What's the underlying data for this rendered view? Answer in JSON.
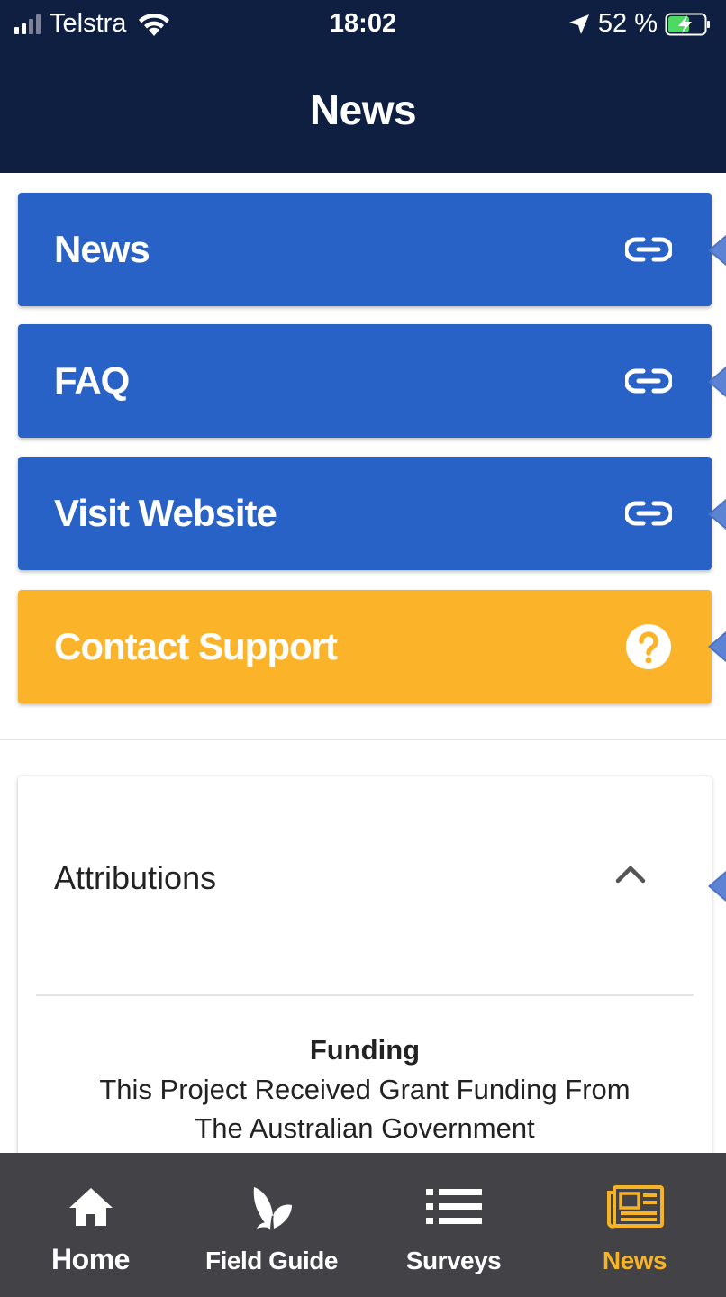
{
  "status_bar": {
    "carrier": "Telstra",
    "time": "18:02",
    "battery_percent": "52 %"
  },
  "header": {
    "title": "News"
  },
  "links": [
    {
      "label": "News",
      "icon": "link-icon"
    },
    {
      "label": "FAQ",
      "icon": "link-icon"
    },
    {
      "label": "Visit Website",
      "icon": "link-icon"
    },
    {
      "label": "Contact Support",
      "icon": "question-circle-icon"
    }
  ],
  "colors": {
    "header_bg": "#0e1f42",
    "link_button": "#2862c6",
    "support_button": "#fbb42a",
    "tabbar_bg": "#434246",
    "tab_active": "#f5b325"
  },
  "attributions": {
    "title": "Attributions",
    "expanded": true,
    "heading": "Funding",
    "body_line1": "This Project Received Grant Funding From",
    "body_line2": "The Australian Government"
  },
  "tabs": [
    {
      "label": "Home",
      "icon": "home-icon",
      "active": false
    },
    {
      "label": "Field Guide",
      "icon": "butterfly-icon",
      "active": false
    },
    {
      "label": "Surveys",
      "icon": "list-icon",
      "active": false
    },
    {
      "label": "News",
      "icon": "newspaper-icon",
      "active": true
    }
  ]
}
